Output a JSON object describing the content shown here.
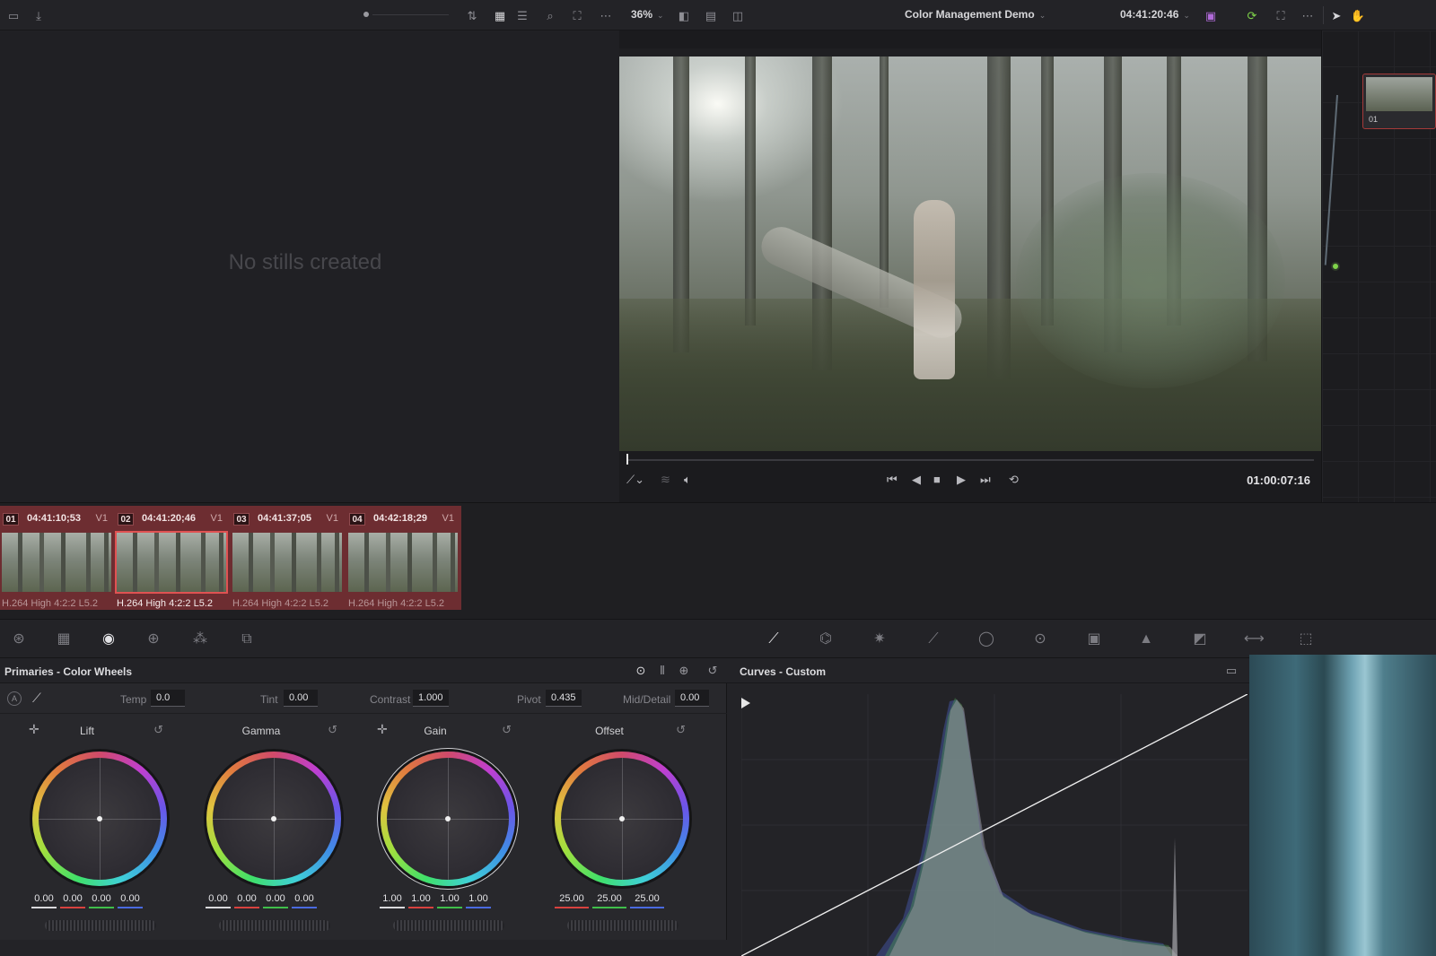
{
  "toolbar": {
    "zoom": "36%",
    "project_name": "Color Management Demo",
    "timecode": "04:41:20:46"
  },
  "gallery": {
    "empty_text": "No stills created"
  },
  "viewer": {
    "timecode": "01:00:07:16"
  },
  "nodes": {
    "node_label": "01"
  },
  "clips": [
    {
      "num": "01",
      "tc": "04:41:10;53",
      "track": "V1",
      "codec": "H.264 High 4:2:2 L5.2"
    },
    {
      "num": "02",
      "tc": "04:41:20;46",
      "track": "V1",
      "codec": "H.264 High 4:2:2 L5.2"
    },
    {
      "num": "03",
      "tc": "04:41:37;05",
      "track": "V1",
      "codec": "H.264 High 4:2:2 L5.2"
    },
    {
      "num": "04",
      "tc": "04:42:18;29",
      "track": "V1",
      "codec": "H.264 High 4:2:2 L5.2"
    }
  ],
  "primaries": {
    "title": "Primaries - Color Wheels",
    "temp_label": "Temp",
    "temp_value": "0.0",
    "tint_label": "Tint",
    "tint_value": "0.00",
    "contrast_label": "Contrast",
    "contrast_value": "1.000",
    "pivot_label": "Pivot",
    "pivot_value": "0.435",
    "middetail_label": "Mid/Detail",
    "middetail_value": "0.00",
    "wheels": [
      {
        "name": "Lift",
        "values": [
          "0.00",
          "0.00",
          "0.00",
          "0.00"
        ]
      },
      {
        "name": "Gamma",
        "values": [
          "0.00",
          "0.00",
          "0.00",
          "0.00"
        ]
      },
      {
        "name": "Gain",
        "values": [
          "1.00",
          "1.00",
          "1.00",
          "1.00"
        ]
      },
      {
        "name": "Offset",
        "values": [
          "25.00",
          "25.00",
          "25.00"
        ]
      }
    ]
  },
  "curves": {
    "title": "Curves - Custom"
  },
  "colors": {
    "accent_red": "#e05252",
    "clip_bg": "#6d2d31",
    "node_output": "#7fd34a"
  }
}
